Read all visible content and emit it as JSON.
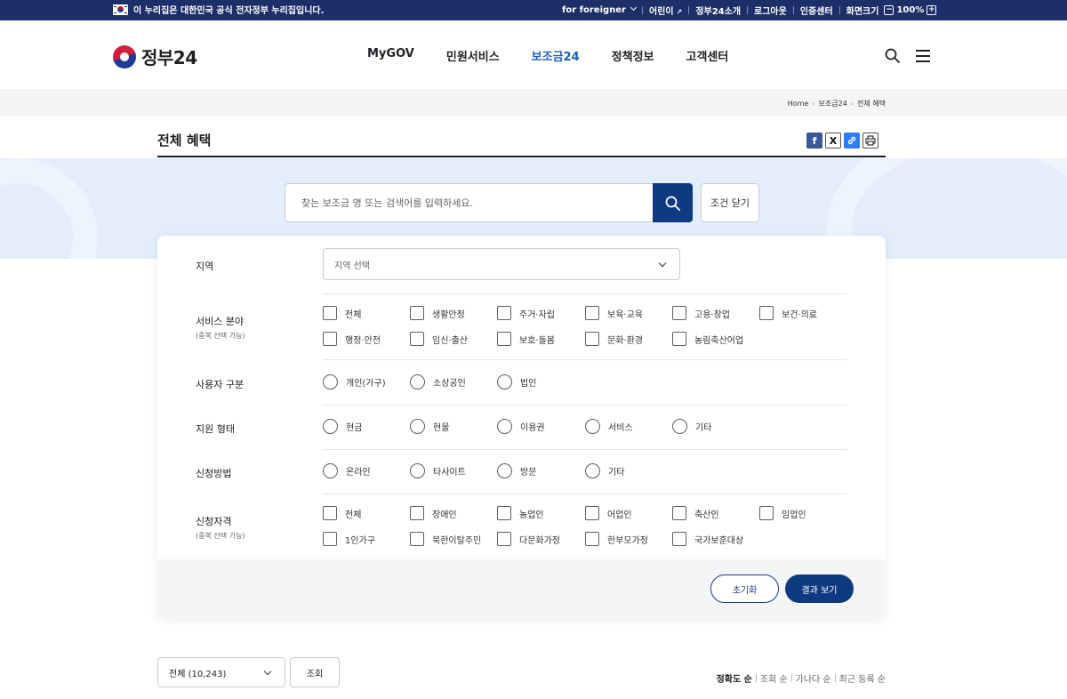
{
  "topbar": {
    "gov_notice": "이 누리집은 대한민국 공식 전자정부 누리집입니다.",
    "foreigner": "for foreigner",
    "kids": "어린이",
    "intro": "정부24소개",
    "logout": "로그아웃",
    "cert": "인증센터",
    "screen_size": "화면크기",
    "zoom_minus": "−",
    "zoom_value": "100%",
    "zoom_plus": "+"
  },
  "header": {
    "logo": "정부24",
    "nav": [
      "MyGOV",
      "민원서비스",
      "보조금24",
      "정책정보",
      "고객센터"
    ],
    "active_nav": "보조금24"
  },
  "breadcrumb": [
    "Home",
    "보조금24",
    "전체 혜택"
  ],
  "page_title": "전체 혜택",
  "share": {
    "facebook": "f",
    "x": "X",
    "link": "🔗",
    "print": "⎙"
  },
  "search": {
    "placeholder": "찾는 보조금 명 또는 검색어를 입력하세요.",
    "close_conditions": "조건 닫기"
  },
  "filters": {
    "region": {
      "label": "지역",
      "placeholder": "지역 선택"
    },
    "service": {
      "label": "서비스 분야",
      "sub": "(중복 선택 가능)",
      "options": [
        "전체",
        "생활안정",
        "주거·자립",
        "보육·교육",
        "고용·창업",
        "보건·의료",
        "행정·안전",
        "임신·출산",
        "보호·돌봄",
        "문화·환경",
        "농림축산어업"
      ]
    },
    "user_type": {
      "label": "사용자 구분",
      "options": [
        "개인(가구)",
        "소상공인",
        "법인"
      ]
    },
    "support_type": {
      "label": "지원 형태",
      "options": [
        "현금",
        "현물",
        "이용권",
        "서비스",
        "기타"
      ]
    },
    "apply_method": {
      "label": "신청방법",
      "options": [
        "온라인",
        "타사이트",
        "방문",
        "기타"
      ]
    },
    "eligibility": {
      "label": "신청자격",
      "sub": "(중복 선택 가능)",
      "options": [
        "전체",
        "장애인",
        "농업인",
        "어업인",
        "축산인",
        "임업인",
        "1인가구",
        "북한이탈주민",
        "다문화가정",
        "한부모가정",
        "국가보훈대상"
      ]
    },
    "reset": "초기화",
    "show_results": "결과 보기"
  },
  "results": {
    "total_select": "전체 (10,243)",
    "view_button": "조회",
    "sorts": [
      "정확도 순",
      "조회 순",
      "가나다 순",
      "최근 등록 순"
    ]
  }
}
